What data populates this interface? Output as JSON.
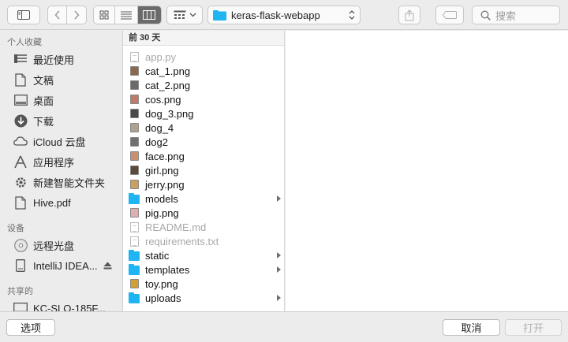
{
  "toolbar": {
    "path_label": "keras-flask-webapp",
    "search_placeholder": "搜索"
  },
  "sidebar": {
    "favorites_title": "个人收藏",
    "favorites": [
      {
        "label": "最近使用",
        "icon": "recents-icon"
      },
      {
        "label": "文稿",
        "icon": "document-icon"
      },
      {
        "label": "桌面",
        "icon": "desktop-icon"
      },
      {
        "label": "下载",
        "icon": "download-icon"
      },
      {
        "label": "iCloud 云盘",
        "icon": "cloud-icon"
      },
      {
        "label": "应用程序",
        "icon": "applications-icon"
      },
      {
        "label": "新建智能文件夹",
        "icon": "smart-folder-icon"
      },
      {
        "label": "Hive.pdf",
        "icon": "pdf-file-icon"
      }
    ],
    "devices_title": "设备",
    "devices": [
      {
        "label": "远程光盘",
        "icon": "optical-disc-icon"
      },
      {
        "label": "IntelliJ IDEA...",
        "icon": "disk-icon"
      }
    ],
    "shared_title": "共享的",
    "shared": [
      {
        "label": "KC-SLO-185F...",
        "icon": "computer-icon"
      }
    ]
  },
  "column": {
    "header": "前 30 天",
    "files": [
      {
        "name": "app.py",
        "kind": "doc",
        "dim": true
      },
      {
        "name": "cat_1.png",
        "kind": "image",
        "color": "#8a6a4a"
      },
      {
        "name": "cat_2.png",
        "kind": "image",
        "color": "#6a6a6a"
      },
      {
        "name": "cos.png",
        "kind": "image",
        "color": "#c07a6a"
      },
      {
        "name": "dog_3.png",
        "kind": "image",
        "color": "#4a4a4a"
      },
      {
        "name": "dog_4",
        "kind": "image",
        "color": "#b0a090"
      },
      {
        "name": "dog2",
        "kind": "image",
        "color": "#707070"
      },
      {
        "name": "face.png",
        "kind": "image",
        "color": "#c89070"
      },
      {
        "name": "girl.png",
        "kind": "image",
        "color": "#5a4a3a"
      },
      {
        "name": "jerry.png",
        "kind": "image",
        "color": "#c8a060"
      },
      {
        "name": "models",
        "kind": "folder",
        "arrow": true
      },
      {
        "name": "pig.png",
        "kind": "image",
        "color": "#e0b0b0"
      },
      {
        "name": "README.md",
        "kind": "doc",
        "dim": true
      },
      {
        "name": "requirements.txt",
        "kind": "doc",
        "dim": true
      },
      {
        "name": "static",
        "kind": "folder",
        "arrow": true
      },
      {
        "name": "templates",
        "kind": "folder",
        "arrow": true
      },
      {
        "name": "toy.png",
        "kind": "image",
        "color": "#d0a030"
      },
      {
        "name": "uploads",
        "kind": "folder",
        "arrow": true
      }
    ]
  },
  "bottom": {
    "options_label": "选项",
    "cancel_label": "取消",
    "open_label": "打开"
  }
}
